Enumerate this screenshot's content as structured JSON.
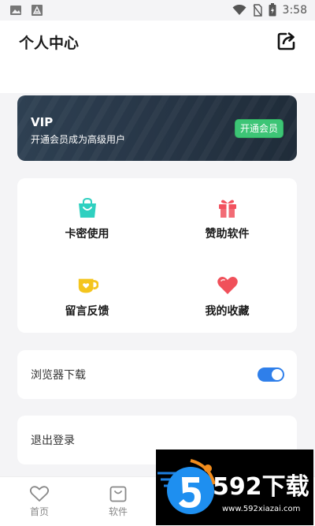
{
  "status_bar": {
    "time": "3:58"
  },
  "header": {
    "title": "个人中心"
  },
  "vip": {
    "title": "VIP",
    "subtitle": "开通会员成为高级用户",
    "button": "开通会员"
  },
  "grid": [
    {
      "label": "卡密使用",
      "icon": "shopping-bag-icon",
      "color": "#2fd0c0"
    },
    {
      "label": "赞助软件",
      "icon": "gift-icon",
      "color": "#f2525f"
    },
    {
      "label": "留言反馈",
      "icon": "cup-icon",
      "color": "#f4c51e"
    },
    {
      "label": "我的收藏",
      "icon": "heart-icon",
      "color": "#f0505a"
    }
  ],
  "settings": {
    "browser_download": {
      "label": "浏览器下载",
      "enabled": true
    },
    "logout": {
      "label": "退出登录"
    }
  },
  "tabs": [
    {
      "label": "首页",
      "icon": "heart-outline-icon"
    },
    {
      "label": "软件",
      "icon": "bag-outline-icon"
    }
  ],
  "watermark": {
    "name": "592下载",
    "url": "www.592xiazai.com"
  },
  "colors": {
    "accent": "#2f7fea",
    "vip_button": "#3dc576",
    "vip_card": "#283748"
  }
}
